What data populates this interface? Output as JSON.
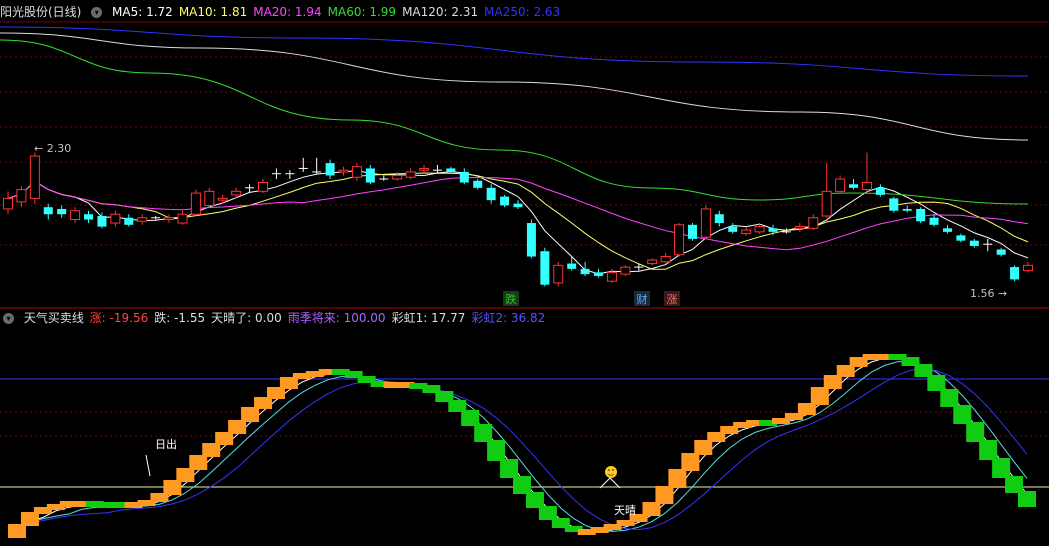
{
  "top": {
    "title": "阳光股份(日线)",
    "ma": [
      {
        "label": "MA5: 1.72",
        "color": "#ffffff"
      },
      {
        "label": "MA10: 1.81",
        "color": "#ffff66"
      },
      {
        "label": "MA20: 1.94",
        "color": "#ff44ff"
      },
      {
        "label": "MA60: 1.99",
        "color": "#33dd33"
      },
      {
        "label": "MA120: 2.31",
        "color": "#dddddd"
      },
      {
        "label": "MA250: 2.63",
        "color": "#3333ff"
      }
    ],
    "high_marker": "2.30",
    "low_marker": "1.56",
    "signals": [
      {
        "text": "跌",
        "color": "#22cc22",
        "bg": "#1a3a1a"
      },
      {
        "text": "财",
        "color": "#66aaff",
        "bg": "#1a2a3a"
      },
      {
        "text": "涨",
        "color": "#ff6666",
        "bg": "#3a1a1a"
      }
    ]
  },
  "bottom": {
    "title": "天气买卖线",
    "values": [
      {
        "label": "涨: -19.56",
        "color": "#ff4444"
      },
      {
        "label": "跌: -1.55",
        "color": "#dddddd"
      },
      {
        "label": "天晴了: 0.00",
        "color": "#dddddd"
      },
      {
        "label": "雨季将来: 100.00",
        "color": "#aa66ff"
      },
      {
        "label": "彩虹1: 17.77",
        "color": "#dddddd"
      },
      {
        "label": "彩虹2: 36.82",
        "color": "#5555ff"
      }
    ],
    "annotations": {
      "sunrise": "日出",
      "sunny": "天晴"
    }
  },
  "chart_data": {
    "type": "candlestick",
    "candles": [
      {
        "o": 1.96,
        "c": 2.02,
        "h": 2.06,
        "l": 1.93
      },
      {
        "o": 2.0,
        "c": 2.07,
        "h": 2.09,
        "l": 1.97
      },
      {
        "o": 2.02,
        "c": 2.26,
        "h": 2.28,
        "l": 1.99
      },
      {
        "o": 1.97,
        "c": 1.93,
        "h": 1.99,
        "l": 1.9
      },
      {
        "o": 1.96,
        "c": 1.93,
        "h": 1.98,
        "l": 1.91
      },
      {
        "o": 1.9,
        "c": 1.95,
        "h": 1.97,
        "l": 1.88
      },
      {
        "o": 1.93,
        "c": 1.9,
        "h": 1.95,
        "l": 1.88
      },
      {
        "o": 1.92,
        "c": 1.86,
        "h": 1.94,
        "l": 1.85
      },
      {
        "o": 1.88,
        "c": 1.93,
        "h": 1.95,
        "l": 1.86
      },
      {
        "o": 1.91,
        "c": 1.87,
        "h": 1.93,
        "l": 1.86
      },
      {
        "o": 1.89,
        "c": 1.91,
        "h": 1.93,
        "l": 1.87
      },
      {
        "o": 1.91,
        "c": 1.91,
        "h": 1.92,
        "l": 1.9
      },
      {
        "o": 1.9,
        "c": 1.91,
        "h": 1.93,
        "l": 1.88
      },
      {
        "o": 1.88,
        "c": 1.93,
        "h": 1.95,
        "l": 1.87
      },
      {
        "o": 1.93,
        "c": 2.05,
        "h": 2.07,
        "l": 1.92
      },
      {
        "o": 1.98,
        "c": 2.06,
        "h": 2.08,
        "l": 1.97
      },
      {
        "o": 2.01,
        "c": 2.02,
        "h": 2.04,
        "l": 1.99
      },
      {
        "o": 2.04,
        "c": 2.06,
        "h": 2.08,
        "l": 2.02
      },
      {
        "o": 2.08,
        "c": 2.08,
        "h": 2.1,
        "l": 2.05
      },
      {
        "o": 2.06,
        "c": 2.11,
        "h": 2.13,
        "l": 2.05
      },
      {
        "o": 2.16,
        "c": 2.16,
        "h": 2.19,
        "l": 2.13
      },
      {
        "o": 2.16,
        "c": 2.16,
        "h": 2.18,
        "l": 2.13
      },
      {
        "o": 2.19,
        "c": 2.19,
        "h": 2.25,
        "l": 2.17
      },
      {
        "o": 2.17,
        "c": 2.17,
        "h": 2.25,
        "l": 2.16
      },
      {
        "o": 2.22,
        "c": 2.15,
        "h": 2.24,
        "l": 2.13
      },
      {
        "o": 2.17,
        "c": 2.18,
        "h": 2.2,
        "l": 2.15
      },
      {
        "o": 2.14,
        "c": 2.2,
        "h": 2.22,
        "l": 2.12
      },
      {
        "o": 2.19,
        "c": 2.11,
        "h": 2.21,
        "l": 2.1
      },
      {
        "o": 2.13,
        "c": 2.13,
        "h": 2.15,
        "l": 2.12
      },
      {
        "o": 2.13,
        "c": 2.15,
        "h": 2.17,
        "l": 2.12
      },
      {
        "o": 2.14,
        "c": 2.17,
        "h": 2.19,
        "l": 2.13
      },
      {
        "o": 2.18,
        "c": 2.19,
        "h": 2.21,
        "l": 2.16
      },
      {
        "o": 2.18,
        "c": 2.18,
        "h": 2.21,
        "l": 2.16
      },
      {
        "o": 2.19,
        "c": 2.17,
        "h": 2.2,
        "l": 2.16
      },
      {
        "o": 2.17,
        "c": 2.11,
        "h": 2.19,
        "l": 2.1
      },
      {
        "o": 2.12,
        "c": 2.08,
        "h": 2.13,
        "l": 2.07
      },
      {
        "o": 2.08,
        "c": 2.01,
        "h": 2.1,
        "l": 1.99
      },
      {
        "o": 2.03,
        "c": 1.98,
        "h": 2.04,
        "l": 1.97
      },
      {
        "o": 1.99,
        "c": 1.97,
        "h": 2.01,
        "l": 1.96
      },
      {
        "o": 1.88,
        "c": 1.69,
        "h": 1.9,
        "l": 1.68
      },
      {
        "o": 1.72,
        "c": 1.53,
        "h": 1.74,
        "l": 1.52
      },
      {
        "o": 1.54,
        "c": 1.64,
        "h": 1.66,
        "l": 1.52
      },
      {
        "o": 1.65,
        "c": 1.62,
        "h": 1.69,
        "l": 1.61
      },
      {
        "o": 1.62,
        "c": 1.59,
        "h": 1.66,
        "l": 1.58
      },
      {
        "o": 1.6,
        "c": 1.58,
        "h": 1.62,
        "l": 1.57
      },
      {
        "o": 1.55,
        "c": 1.6,
        "h": 1.62,
        "l": 1.54
      },
      {
        "o": 1.59,
        "c": 1.63,
        "h": 1.64,
        "l": 1.58
      },
      {
        "o": 1.63,
        "c": 1.63,
        "h": 1.65,
        "l": 1.61
      },
      {
        "o": 1.65,
        "c": 1.67,
        "h": 1.68,
        "l": 1.64
      },
      {
        "o": 1.66,
        "c": 1.69,
        "h": 1.71,
        "l": 1.65
      },
      {
        "o": 1.7,
        "c": 1.87,
        "h": 1.88,
        "l": 1.69
      },
      {
        "o": 1.87,
        "c": 1.79,
        "h": 1.88,
        "l": 1.78
      },
      {
        "o": 1.8,
        "c": 1.96,
        "h": 1.98,
        "l": 1.79
      },
      {
        "o": 1.93,
        "c": 1.88,
        "h": 1.95,
        "l": 1.86
      },
      {
        "o": 1.86,
        "c": 1.83,
        "h": 1.88,
        "l": 1.82
      },
      {
        "o": 1.82,
        "c": 1.84,
        "h": 1.86,
        "l": 1.81
      },
      {
        "o": 1.83,
        "c": 1.86,
        "h": 1.88,
        "l": 1.82
      },
      {
        "o": 1.85,
        "c": 1.83,
        "h": 1.87,
        "l": 1.81
      },
      {
        "o": 1.83,
        "c": 1.83,
        "h": 1.85,
        "l": 1.82
      },
      {
        "o": 1.85,
        "c": 1.86,
        "h": 1.88,
        "l": 1.83
      },
      {
        "o": 1.85,
        "c": 1.91,
        "h": 1.93,
        "l": 1.84
      },
      {
        "o": 1.92,
        "c": 2.06,
        "h": 2.22,
        "l": 1.91
      },
      {
        "o": 2.06,
        "c": 2.13,
        "h": 2.15,
        "l": 2.05
      },
      {
        "o": 2.1,
        "c": 2.08,
        "h": 2.13,
        "l": 2.07
      },
      {
        "o": 2.07,
        "c": 2.11,
        "h": 2.28,
        "l": 2.05
      },
      {
        "o": 2.08,
        "c": 2.04,
        "h": 2.1,
        "l": 2.03
      },
      {
        "o": 2.02,
        "c": 1.95,
        "h": 2.03,
        "l": 1.94
      },
      {
        "o": 1.96,
        "c": 1.95,
        "h": 1.98,
        "l": 1.94
      },
      {
        "o": 1.96,
        "c": 1.89,
        "h": 1.97,
        "l": 1.88
      },
      {
        "o": 1.91,
        "c": 1.87,
        "h": 1.93,
        "l": 1.86
      },
      {
        "o": 1.85,
        "c": 1.83,
        "h": 1.87,
        "l": 1.82
      },
      {
        "o": 1.81,
        "c": 1.78,
        "h": 1.82,
        "l": 1.77
      },
      {
        "o": 1.78,
        "c": 1.75,
        "h": 1.79,
        "l": 1.74
      },
      {
        "o": 1.76,
        "c": 1.76,
        "h": 1.79,
        "l": 1.72
      },
      {
        "o": 1.73,
        "c": 1.7,
        "h": 1.74,
        "l": 1.69
      },
      {
        "o": 1.63,
        "c": 1.56,
        "h": 1.64,
        "l": 1.55
      },
      {
        "o": 1.61,
        "c": 1.64,
        "h": 1.66,
        "l": 1.6
      }
    ],
    "weather": [
      {
        "v": 14,
        "u": true
      },
      {
        "v": 26,
        "u": true
      },
      {
        "v": 31,
        "u": true
      },
      {
        "v": 34,
        "u": true
      },
      {
        "v": 37,
        "u": true
      },
      {
        "v": 37,
        "u": true
      },
      {
        "v": 36,
        "u": false
      },
      {
        "v": 36,
        "u": false
      },
      {
        "v": 36,
        "u": false
      },
      {
        "v": 36,
        "u": true
      },
      {
        "v": 38,
        "u": true
      },
      {
        "v": 45,
        "u": true
      },
      {
        "v": 58,
        "u": true
      },
      {
        "v": 70,
        "u": true
      },
      {
        "v": 83,
        "u": true
      },
      {
        "v": 95,
        "u": true
      },
      {
        "v": 106,
        "u": true
      },
      {
        "v": 118,
        "u": true
      },
      {
        "v": 131,
        "u": true
      },
      {
        "v": 141,
        "u": true
      },
      {
        "v": 151,
        "u": true
      },
      {
        "v": 161,
        "u": true
      },
      {
        "v": 165,
        "u": true
      },
      {
        "v": 167,
        "u": true
      },
      {
        "v": 169,
        "u": true
      },
      {
        "v": 167,
        "u": false
      },
      {
        "v": 162,
        "u": false
      },
      {
        "v": 157,
        "u": false
      },
      {
        "v": 155,
        "u": false
      },
      {
        "v": 156,
        "u": true
      },
      {
        "v": 155,
        "u": true
      },
      {
        "v": 153,
        "u": false
      },
      {
        "v": 147,
        "u": false
      },
      {
        "v": 138,
        "u": false
      },
      {
        "v": 128,
        "u": false
      },
      {
        "v": 114,
        "u": false
      },
      {
        "v": 98,
        "u": false
      },
      {
        "v": 79,
        "u": false
      },
      {
        "v": 62,
        "u": false
      },
      {
        "v": 46,
        "u": false
      },
      {
        "v": 32,
        "u": false
      },
      {
        "v": 20,
        "u": false
      },
      {
        "v": 12,
        "u": false
      },
      {
        "v": 9,
        "u": false
      },
      {
        "v": 9,
        "u": true
      },
      {
        "v": 11,
        "u": true
      },
      {
        "v": 14,
        "u": true
      },
      {
        "v": 18,
        "u": true
      },
      {
        "v": 24,
        "u": true
      },
      {
        "v": 36,
        "u": true
      },
      {
        "v": 52,
        "u": true
      },
      {
        "v": 69,
        "u": true
      },
      {
        "v": 85,
        "u": true
      },
      {
        "v": 98,
        "u": true
      },
      {
        "v": 106,
        "u": true
      },
      {
        "v": 112,
        "u": true
      },
      {
        "v": 116,
        "u": true
      },
      {
        "v": 118,
        "u": true
      },
      {
        "v": 118,
        "u": false
      },
      {
        "v": 120,
        "u": true
      },
      {
        "v": 125,
        "u": true
      },
      {
        "v": 135,
        "u": true
      },
      {
        "v": 151,
        "u": true
      },
      {
        "v": 163,
        "u": true
      },
      {
        "v": 173,
        "u": true
      },
      {
        "v": 181,
        "u": true
      },
      {
        "v": 184,
        "u": true
      },
      {
        "v": 184,
        "u": true
      },
      {
        "v": 181,
        "u": false
      },
      {
        "v": 174,
        "u": false
      },
      {
        "v": 163,
        "u": false
      },
      {
        "v": 149,
        "u": false
      },
      {
        "v": 133,
        "u": false
      },
      {
        "v": 116,
        "u": false
      },
      {
        "v": 98,
        "u": false
      },
      {
        "v": 80,
        "u": false
      },
      {
        "v": 62,
        "u": false
      },
      {
        "v": 47,
        "u": false
      },
      {
        "v": 33,
        "u": false
      }
    ]
  }
}
